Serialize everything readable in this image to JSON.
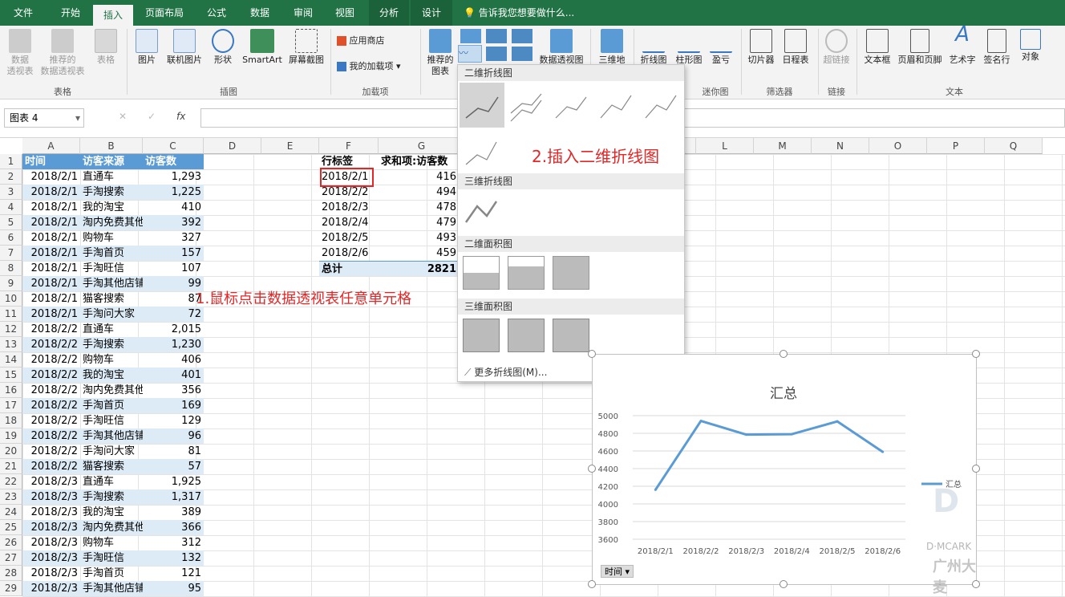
{
  "tabs": [
    "文件",
    "开始",
    "插入",
    "页面布局",
    "公式",
    "数据",
    "审阅",
    "视图",
    "分析",
    "设计"
  ],
  "tellme": "告诉我您想要做什么...",
  "ribbon": {
    "pivot": "数据\n透视表",
    "rec_pivot": "推荐的\n数据透视表",
    "table": "表格",
    "g_table": "表格",
    "picture": "图片",
    "online_picture": "联机图片",
    "shapes": "形状",
    "smartart": "SmartArt",
    "screenshot": "屏幕截图",
    "g_illust": "插图",
    "store": "应用商店",
    "my_addins": "我的加载项",
    "g_addins": "加载项",
    "rec_charts": "推荐的\n图表",
    "pivot_chart": "数据透视图",
    "map3d": "三维地",
    "line": "折线图",
    "column": "柱形图",
    "winloss": "盈亏",
    "g_spark": "迷你图",
    "slicer": "切片器",
    "timeline": "日程表",
    "g_filter": "筛选器",
    "hyperlink": "超链接",
    "g_links": "链接",
    "textbox": "文本框",
    "header_footer": "页眉和页脚",
    "wordart": "艺术字",
    "signature": "签名行",
    "object": "对象",
    "g_text": "文本"
  },
  "namebox": "图表 4",
  "fx": "fx",
  "columns": [
    "A",
    "B",
    "C",
    "D",
    "E",
    "F",
    "G",
    "H",
    "I",
    "J",
    "K",
    "L",
    "M",
    "N",
    "O",
    "P",
    "Q"
  ],
  "table": {
    "headers": [
      "时间",
      "访客来源",
      "访客数"
    ],
    "rows": [
      [
        "2018/2/1",
        "直通车",
        "1,293"
      ],
      [
        "2018/2/1",
        "手淘搜索",
        "1,225"
      ],
      [
        "2018/2/1",
        "我的淘宝",
        "410"
      ],
      [
        "2018/2/1",
        "淘内免费其他",
        "392"
      ],
      [
        "2018/2/1",
        "购物车",
        "327"
      ],
      [
        "2018/2/1",
        "手淘首页",
        "157"
      ],
      [
        "2018/2/1",
        "手淘旺信",
        "107"
      ],
      [
        "2018/2/1",
        "手淘其他店铺",
        "99"
      ],
      [
        "2018/2/1",
        "猫客搜索",
        "87"
      ],
      [
        "2018/2/1",
        "手淘问大家",
        "72"
      ],
      [
        "2018/2/2",
        "直通车",
        "2,015"
      ],
      [
        "2018/2/2",
        "手淘搜索",
        "1,230"
      ],
      [
        "2018/2/2",
        "购物车",
        "406"
      ],
      [
        "2018/2/2",
        "我的淘宝",
        "401"
      ],
      [
        "2018/2/2",
        "淘内免费其他",
        "356"
      ],
      [
        "2018/2/2",
        "手淘首页",
        "169"
      ],
      [
        "2018/2/2",
        "手淘旺信",
        "129"
      ],
      [
        "2018/2/2",
        "手淘其他店铺",
        "96"
      ],
      [
        "2018/2/2",
        "手淘问大家",
        "81"
      ],
      [
        "2018/2/2",
        "猫客搜索",
        "57"
      ],
      [
        "2018/2/3",
        "直通车",
        "1,925"
      ],
      [
        "2018/2/3",
        "手淘搜索",
        "1,317"
      ],
      [
        "2018/2/3",
        "我的淘宝",
        "389"
      ],
      [
        "2018/2/3",
        "淘内免费其他",
        "366"
      ],
      [
        "2018/2/3",
        "购物车",
        "312"
      ],
      [
        "2018/2/3",
        "手淘旺信",
        "132"
      ],
      [
        "2018/2/3",
        "手淘首页",
        "121"
      ],
      [
        "2018/2/3",
        "手淘其他店铺",
        "95"
      ]
    ]
  },
  "pivot": {
    "header_row": "行标签",
    "header_sum": "求和项:访客数",
    "rows": [
      [
        "2018/2/1",
        "416"
      ],
      [
        "2018/2/2",
        "494"
      ],
      [
        "2018/2/3",
        "478"
      ],
      [
        "2018/2/4",
        "479"
      ],
      [
        "2018/2/5",
        "493"
      ],
      [
        "2018/2/6",
        "459"
      ]
    ],
    "total_label": "总计",
    "total": "2821"
  },
  "menu": {
    "sec1": "二维折线图",
    "sec2": "三维折线图",
    "sec3": "二维面积图",
    "sec4": "三维面积图",
    "more": "更多折线图(M)..."
  },
  "annotations": {
    "step1": "1.鼠标点击数据透视表任意单元格",
    "step2": "2.插入二维折线图"
  },
  "spark_group_label": "迷你图",
  "chart_data": {
    "type": "line",
    "title": "汇总",
    "categories": [
      "2018/2/1",
      "2018/2/2",
      "2018/2/3",
      "2018/2/4",
      "2018/2/5",
      "2018/2/6"
    ],
    "series": [
      {
        "name": "汇总",
        "values": [
          4160,
          4940,
          4785,
          4790,
          4935,
          4590
        ]
      }
    ],
    "yticks": [
      "3600",
      "3800",
      "4000",
      "4200",
      "4400",
      "4600",
      "4800",
      "5000"
    ],
    "ylim": [
      3600,
      5000
    ],
    "legend": "right",
    "color": "#5b9bd5",
    "field_button": "时间"
  },
  "watermark": {
    "line1": "D·MCARK",
    "line2": "广州大麦"
  },
  "colors": {
    "excel_green": "#217346",
    "table_header": "#5b9bd5",
    "band": "#ddebf7",
    "annotation": "#e32626"
  }
}
